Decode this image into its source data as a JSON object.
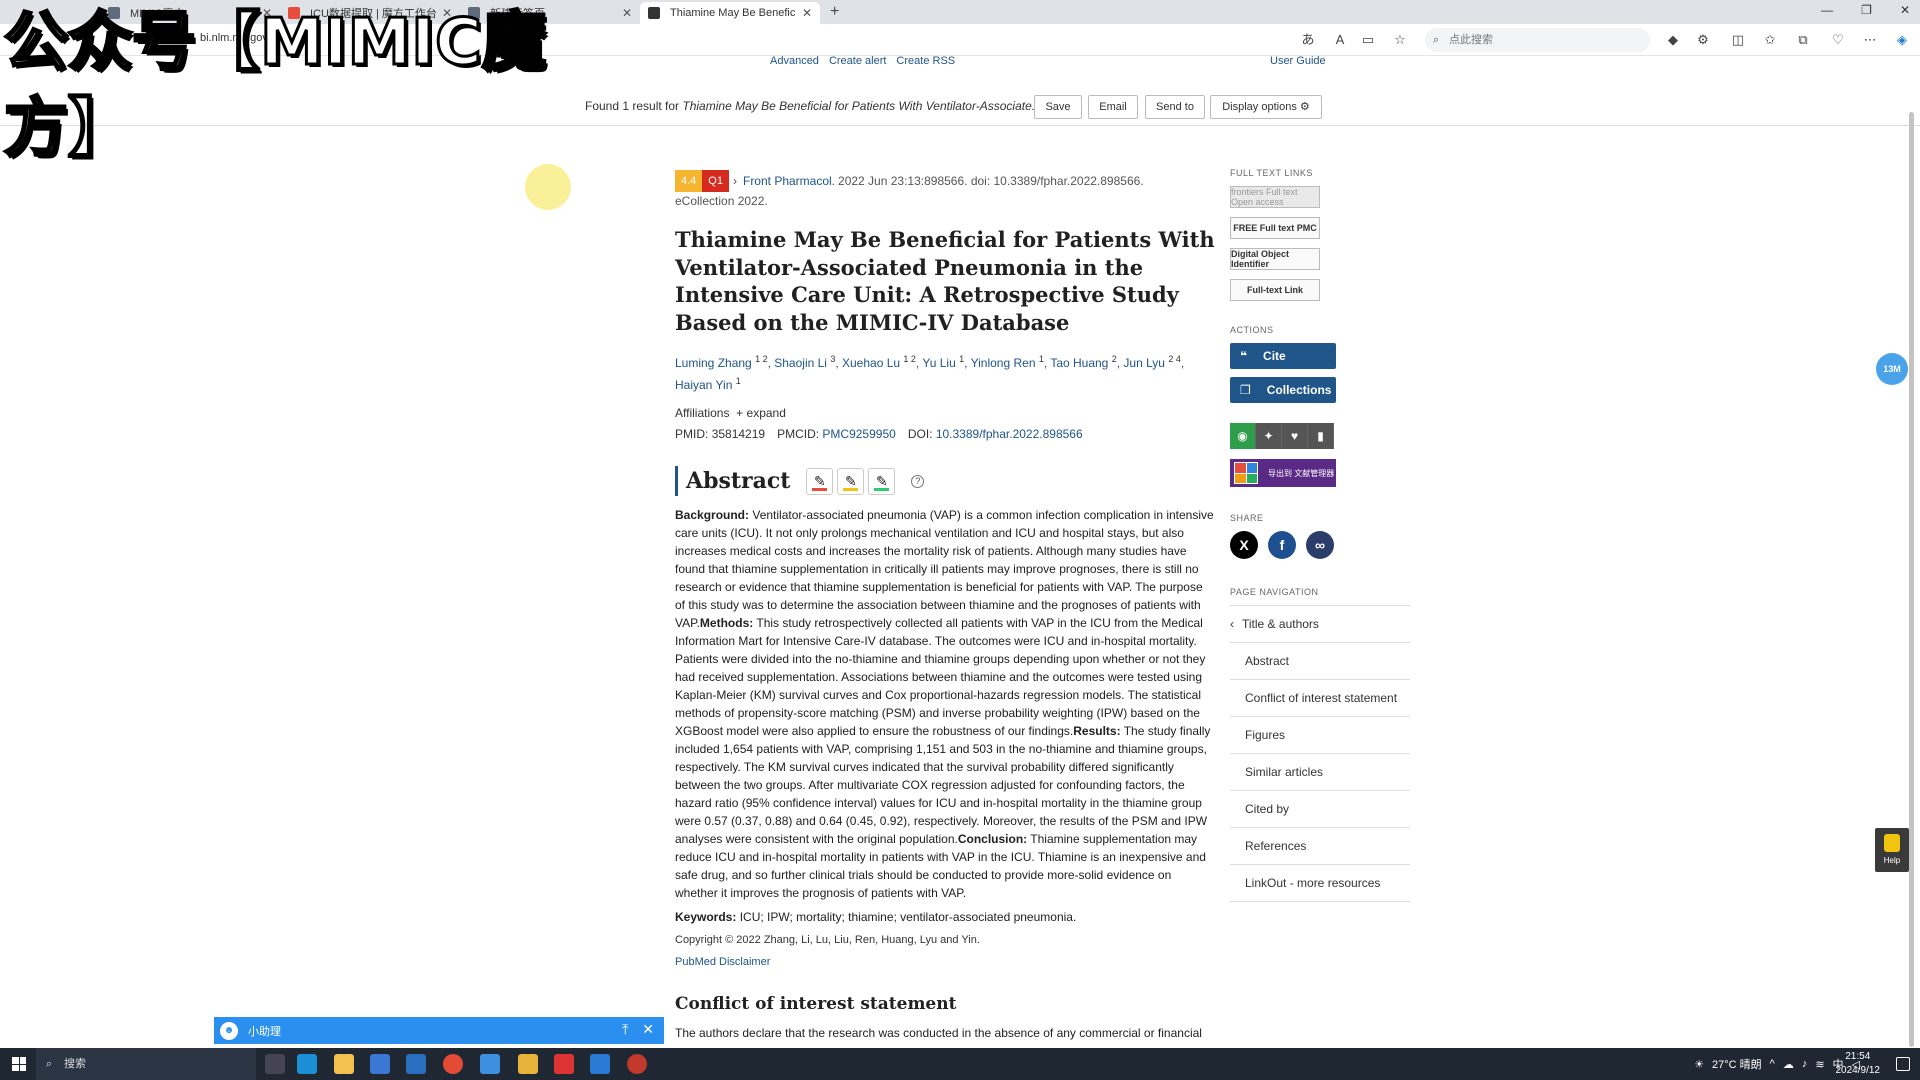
{
  "watermark": "公众号【MIMIC魔方】",
  "browser": {
    "tabs": [
      {
        "title": "MIMIC魔方",
        "active": false
      },
      {
        "title": "ICU数据提取 | 魔方工作台",
        "active": false
      },
      {
        "title": "新建标签页",
        "active": false
      },
      {
        "title": "Thiamine May Be Beneficial for Pa...",
        "active": true
      }
    ],
    "address_partial": "bi.nlm.nih.gov",
    "search_placeholder": "点此搜索"
  },
  "pubmed": {
    "nav_links": [
      "Advanced",
      "Create alert",
      "Create RSS"
    ],
    "user_guide": "User Guide",
    "found_prefix": "Found 1 result for ",
    "found_query": "Thiamine May Be Beneficial for Patients With Ventilator-Associate...",
    "buttons": {
      "save": "Save",
      "email": "Email",
      "send_to": "Send to",
      "display_options": "Display options"
    }
  },
  "article": {
    "impact_factor": "4.4",
    "quartile": "Q1",
    "journal": "Front Pharmacol.",
    "citation": "2022 Jun 23:13:898566. doi: 10.3389/fphar.2022.898566.",
    "ecollection": "eCollection 2022.",
    "title": "Thiamine May Be Beneficial for Patients With Ventilator-Associated Pneumonia in the Intensive Care Unit: A Retrospective Study Based on the MIMIC-IV Database",
    "authors": [
      {
        "name": "Luming Zhang",
        "aff": "1 2"
      },
      {
        "name": "Shaojin Li",
        "aff": "3"
      },
      {
        "name": "Xuehao Lu",
        "aff": "1 2"
      },
      {
        "name": "Yu Liu",
        "aff": "1"
      },
      {
        "name": "Yinlong Ren",
        "aff": "1"
      },
      {
        "name": "Tao Huang",
        "aff": "2"
      },
      {
        "name": "Jun Lyu",
        "aff": "2 4"
      },
      {
        "name": "Haiyan Yin",
        "aff": "1"
      }
    ],
    "affiliations_label": "Affiliations",
    "expand_label": "expand",
    "pmid_label": "PMID:",
    "pmid": "35814219",
    "pmcid_label": "PMCID:",
    "pmcid": "PMC9259950",
    "doi_label": "DOI:",
    "doi": "10.3389/fphar.2022.898566",
    "abstract_heading": "Abstract",
    "abstract": [
      {
        "label": "Background:",
        "text": " Ventilator-associated pneumonia (VAP) is a common infection complication in intensive care units (ICU). It not only prolongs mechanical ventilation and ICU and hospital stays, but also increases medical costs and increases the mortality risk of patients. Although many studies have found that thiamine supplementation in critically ill patients may improve prognoses, there is still no research or evidence that thiamine supplementation is beneficial for patients with VAP. The purpose of this study was to determine the association between thiamine and the prognoses of patients with VAP."
      },
      {
        "label": "Methods:",
        "text": " This study retrospectively collected all patients with VAP in the ICU from the Medical Information Mart for Intensive Care-IV database. The outcomes were ICU and in-hospital mortality. Patients were divided into the no-thiamine and thiamine groups depending upon whether or not they had received supplementation. Associations between thiamine and the outcomes were tested using Kaplan-Meier (KM) survival curves and Cox proportional-hazards regression models. The statistical methods of propensity-score matching (PSM) and inverse probability weighting (IPW) based on the XGBoost model were also applied to ensure the robustness of our findings."
      },
      {
        "label": "Results:",
        "text": " The study finally included 1,654 patients with VAP, comprising 1,151 and 503 in the no-thiamine and thiamine groups, respectively. The KM survival curves indicated that the survival probability differed significantly between the two groups. After multivariate COX regression adjusted for confounding factors, the hazard ratio (95% confidence interval) values for ICU and in-hospital mortality in the thiamine group were 0.57 (0.37, 0.88) and 0.64 (0.45, 0.92), respectively. Moreover, the results of the PSM and IPW analyses were consistent with the original population."
      },
      {
        "label": "Conclusion:",
        "text": " Thiamine supplementation may reduce ICU and in-hospital mortality in patients with VAP in the ICU. Thiamine is an inexpensive and safe drug, and so further clinical trials should be conducted to provide more-solid evidence on whether it improves the prognosis of patients with VAP."
      }
    ],
    "keywords_label": "Keywords:",
    "keywords": "ICU; IPW; mortality; thiamine; ventilator-associated pneumonia.",
    "copyright": "Copyright © 2022 Zhang, Li, Lu, Liu, Ren, Huang, Lyu and Yin.",
    "disclaimer": "PubMed Disclaimer",
    "coi_heading": "Conflict of interest statement",
    "coi_text": "The authors declare that the research was conducted in the absence of any commercial or financial"
  },
  "sidebar": {
    "full_text_label": "FULL TEXT LINKS",
    "full_text_links": [
      "frontiers  Full text Open access",
      "FREE Full text PMC",
      "Digital Object Identifier",
      "Full-text Link"
    ],
    "actions_label": "ACTIONS",
    "cite": "Cite",
    "collections": "Collections",
    "export_label": "导出到 文献管理器",
    "share_label": "SHARE",
    "page_nav_label": "PAGE NAVIGATION",
    "page_nav": [
      "Title & authors",
      "Abstract",
      "Conflict of interest statement",
      "Figures",
      "Similar articles",
      "Cited by",
      "References",
      "LinkOut - more resources"
    ]
  },
  "overlays": {
    "badge": "13M",
    "help": "Help",
    "assistant": "小助理"
  },
  "taskbar": {
    "search": "搜索",
    "weather": "27°C 晴朗",
    "time": "21:54",
    "date": "2024/9/12",
    "ime": "中"
  },
  "colors": {
    "link": "#20558a",
    "if_badge": "#f5b52e",
    "q_badge": "#d52b1e",
    "action_button": "#20558a"
  }
}
